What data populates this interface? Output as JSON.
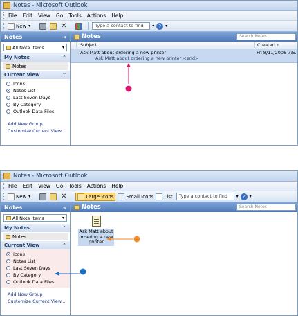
{
  "window": {
    "title": "Notes - Microsoft Outlook"
  },
  "menu": [
    "File",
    "Edit",
    "View",
    "Go",
    "Tools",
    "Actions",
    "Help"
  ],
  "toolbar": {
    "new_label": "New",
    "large_icons": "Large Icons",
    "small_icons": "Small Icons",
    "list": "List",
    "contact_placeholder": "Type a contact to find"
  },
  "nav": {
    "title": "Notes",
    "collapse": "«",
    "folder_select": "All Note Items",
    "my_notes_title": "My Notes",
    "notes_folder": "Notes",
    "current_view_title": "Current View",
    "views": [
      "Icons",
      "Notes List",
      "Last Seven Days",
      "By Category",
      "Outlook Data Files"
    ],
    "add_group": "Add New Group",
    "customize": "Customize Current View..."
  },
  "main": {
    "title": "Notes",
    "search_placeholder": "Search Notes",
    "col_subject": "Subject",
    "col_created": "Created",
    "row": {
      "subject": "Ask Matt about ordering a new printer",
      "created": "Fri 8/11/2006 7:5...",
      "preview": "Ask Matt about ordering a new printer <end>"
    },
    "icon_label": "Ask Matt about ordering a new printer"
  },
  "callouts": {
    "magenta": "#d6186c",
    "orange": "#f08a2a",
    "blue": "#1f6fc0"
  }
}
